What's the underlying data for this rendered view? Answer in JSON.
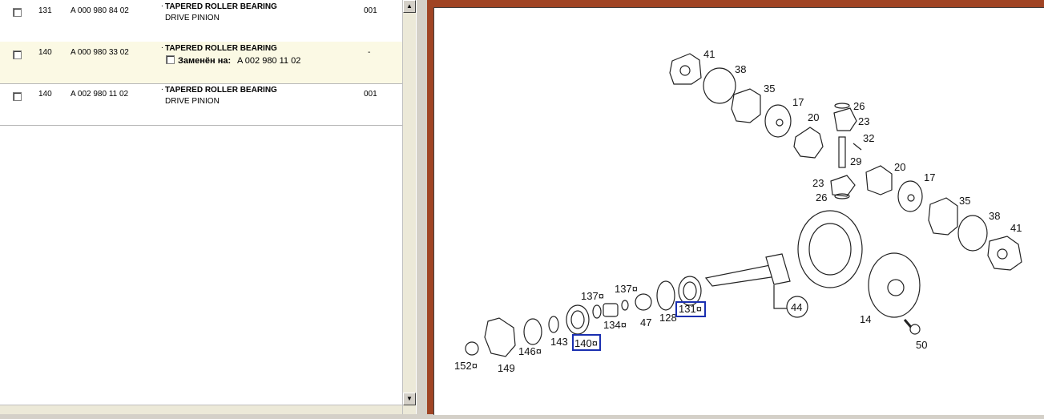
{
  "parts_list": {
    "rows": [
      {
        "pos": "131",
        "part_no": "A 000 980 84 02",
        "desc": "TAPERED ROLLER BEARING",
        "sub": "DRIVE PINION",
        "qty": "001",
        "selected": false
      },
      {
        "pos": "140",
        "part_no": "A 000 980 33 02",
        "desc": "TAPERED ROLLER BEARING",
        "sub_label": "Заменён на:",
        "sub_value": "A 002 980 11 02",
        "qty": "-",
        "selected": true
      },
      {
        "pos": "140",
        "part_no": "A 002 980 11 02",
        "desc": "TAPERED ROLLER BEARING",
        "sub": "DRIVE PINION",
        "qty": "001",
        "selected": false
      }
    ]
  },
  "scrollbar": {
    "up_icon": "arrow-up-icon",
    "down_icon": "arrow-down-icon"
  },
  "diagram": {
    "labels": [
      "41",
      "38",
      "35",
      "17",
      "20",
      "26",
      "23",
      "32",
      "29",
      "20",
      "17",
      "23",
      "26",
      "35",
      "38",
      "41",
      "44",
      "14",
      "50",
      "131¤",
      "128",
      "47",
      "137¤",
      "137¤",
      "134¤",
      "140¤",
      "143",
      "146¤",
      "149",
      "152¤"
    ],
    "highlighted": [
      "131¤",
      "140¤"
    ],
    "highlight_color": "#1a2fb0",
    "frame_color": "#a04424"
  }
}
